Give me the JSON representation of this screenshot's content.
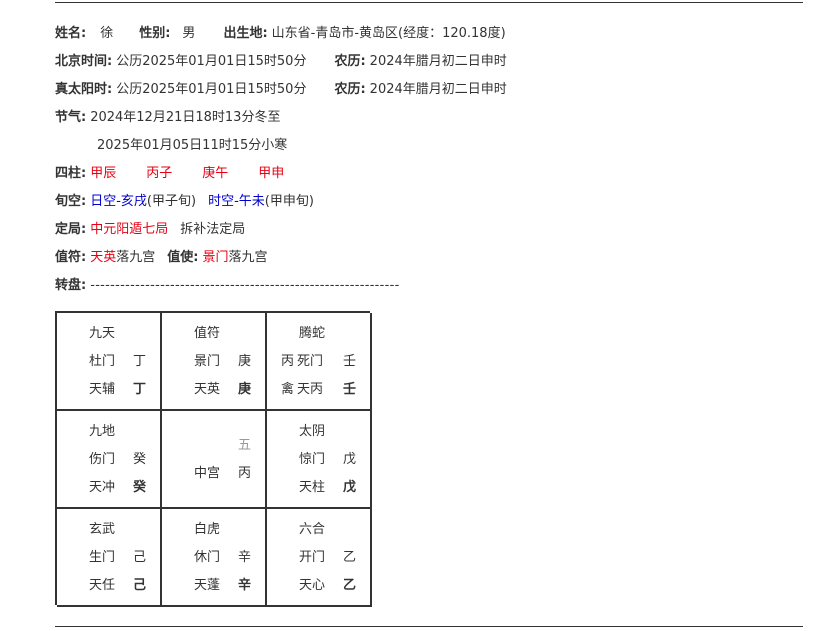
{
  "header": {
    "name_label": "姓名:",
    "name_value": "徐",
    "gender_label": "性别:",
    "gender_value": "男",
    "birthplace_label": "出生地:",
    "birthplace_value": "山东省-青岛市-黄岛区(经度：120.18度)"
  },
  "beijing_time": {
    "label": "北京时间:",
    "value": "公历2025年01月01日15时50分",
    "lunar_label": "农历:",
    "lunar_value": "2024年腊月初二日申时"
  },
  "true_solar_time": {
    "label": "真太阳时:",
    "value": "公历2025年01月01日15时50分",
    "lunar_label": "农历:",
    "lunar_value": "2024年腊月初二日申时"
  },
  "solar_terms": {
    "label": "节气:",
    "term1": "2024年12月21日18时13分冬至",
    "term2": "2025年01月05日11时15分小寒"
  },
  "pillars": {
    "label": "四柱:",
    "year": "甲辰",
    "month": "丙子",
    "day": "庚午",
    "hour": "甲申"
  },
  "void": {
    "label": "旬空:",
    "day_void": "日空-亥戌",
    "day_xun": "(甲子旬)",
    "hour_void": "时空-午未",
    "hour_xun": "(甲申旬)"
  },
  "ju": {
    "label": "定局:",
    "value": "中元阳遁七局",
    "method": "拆补法定局"
  },
  "duty": {
    "zhifu_label": "值符:",
    "zhifu_star": "天英",
    "zhifu_palace": "落九宫",
    "zhishi_label": "值使:",
    "zhishi_door": "景门",
    "zhishi_palace": "落九宫"
  },
  "plate": {
    "label": "转盘:",
    "dashes": "--------------------------------------------------------------"
  },
  "board": [
    {
      "deity": "九天",
      "door": "杜门",
      "heaven_stem": "丁",
      "star": "天辅",
      "earth_stem": "丁"
    },
    {
      "deity": "值符",
      "door": "景门",
      "heaven_stem": "庚",
      "star": "天英",
      "earth_stem": "庚"
    },
    {
      "deity": "腾蛇",
      "door_prefix": "丙",
      "door": "死门",
      "heaven_stem": "壬",
      "star_prefix": "禽",
      "star": "天丙",
      "earth_stem": "壬"
    },
    {
      "deity": "九地",
      "door": "伤门",
      "heaven_stem": "癸",
      "star": "天冲",
      "earth_stem": "癸"
    },
    {
      "number": "五",
      "center": "中宫",
      "earth_stem": "丙"
    },
    {
      "deity": "太阴",
      "door": "惊门",
      "heaven_stem": "戊",
      "star": "天柱",
      "earth_stem": "戊"
    },
    {
      "deity": "玄武",
      "door": "生门",
      "heaven_stem": "己",
      "star": "天任",
      "earth_stem": "己"
    },
    {
      "deity": "白虎",
      "door": "休门",
      "heaven_stem": "辛",
      "star": "天蓬",
      "earth_stem": "辛"
    },
    {
      "deity": "六合",
      "door": "开门",
      "heaven_stem": "乙",
      "star": "天心",
      "earth_stem": "乙"
    }
  ]
}
